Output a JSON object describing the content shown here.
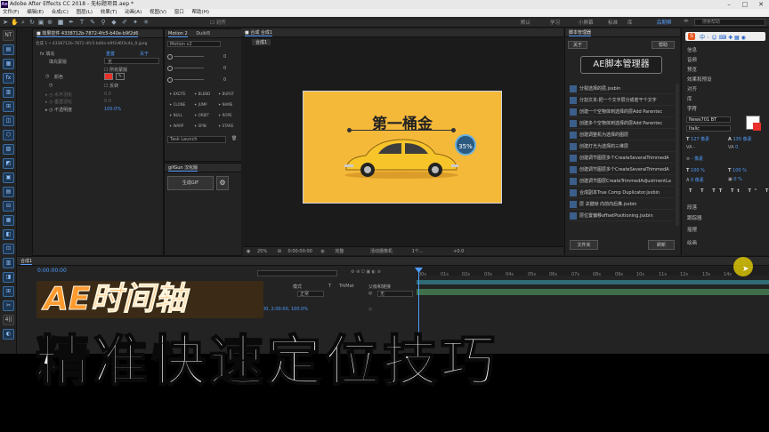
{
  "window": {
    "title": "Adobe After Effects CC 2018 - 无标题项目.aep *",
    "app_badge": "Ae"
  },
  "menu": [
    "文件(F)",
    "编辑(E)",
    "合成(C)",
    "图层(L)",
    "效果(T)",
    "动画(A)",
    "视图(V)",
    "窗口",
    "帮助(H)"
  ],
  "toolbar": {
    "align_label": "对齐",
    "workspaces": [
      "默认",
      "学习",
      "小屏幕",
      "标准",
      "库",
      "后期帮",
      "≫"
    ],
    "active_workspace": "后期帮",
    "search_placeholder": "搜索帮助"
  },
  "effects_panel": {
    "tab": "■ 效果控件 4338712b-7872-4fc5-b40e-b9f2d6",
    "path": "合成 1 • 4338712b-7872-4fc5-b40e-b9f2d6f3c4a_0.jpeg",
    "fx_name": "填充",
    "reset": "重置",
    "about": "关于",
    "mask_label": "填充蒙版",
    "mask_value": "无",
    "all_masks": "所有蒙版",
    "color_label": "颜色",
    "invert": "反转",
    "h_feather": "水平羽化",
    "v_feather": "垂直羽化",
    "opacity_label": "不透明度",
    "opacity_value": "100.0%",
    "feather_value": "0.0"
  },
  "motion_panel": {
    "tabs": [
      "Motion 2",
      "DuikI5"
    ],
    "preset": "Motion v2",
    "value": "0",
    "buttons": [
      "EXCITE",
      "BLEND",
      "BURST",
      "CLONE",
      "JUMP",
      "NAME",
      "NULL",
      "ORBIT",
      "ROPE",
      "WARP",
      "SPIN",
      "STARE"
    ],
    "task": "Task Launch",
    "gif_tab": "gifGun 汉化版",
    "gif_button": "生成GIF"
  },
  "comp_panel": {
    "tab": "■ 合成 合成1",
    "sub_tab": "合成1",
    "zoom": "25%",
    "timecode": "0:00:00:00",
    "quality": "完整",
    "camera": "活动摄像机",
    "views": "1个...",
    "exposure": "+0.0"
  },
  "canvas": {
    "headline": "第一桶金",
    "progress_badge": "35%"
  },
  "script_panel": {
    "tab": "脚本管理器",
    "about": "关于",
    "help": "帮助",
    "logo": "AE脚本管理器",
    "items": [
      "分裂选择的层.jsxbin",
      "分割文本:把一个文字层分成若干个文字",
      "创建一个空物体到选择的层Add Parentec",
      "创建多个空物体到选择的层Add Parentec",
      "创建调整机为选择的图层",
      "创建灯光为选择的三维层",
      "创建调节图层多个CreateSeveralTrimmedA",
      "创建调节图层多个CreateSeveralTrimmedA",
      "创建调节图层CreateTrimmedAdjustmentLa",
      "合成副本True Comp Duplicator.jsxbin",
      "层 关键帧 向前向后推.jsxbin",
      "层位置偏移offsetPositioning.jsxbin"
    ],
    "folder_button": "文件夹",
    "refresh_button": "刷新"
  },
  "right_panel": {
    "items": [
      "信息",
      "音频",
      "预览",
      "效果和预设",
      "对齐",
      "库",
      "字符"
    ],
    "font": "News701 BT",
    "style": "Italic",
    "size": "127 像素",
    "leading": "135 像素",
    "tracking": "0",
    "px_auto": "- 像素",
    "scale_v": "100 %",
    "scale_h": "100 %",
    "baseline": "0 像素",
    "tsume": "0 %",
    "bottom_items": [
      "段落",
      "跟踪器",
      "摇摆",
      "绘画"
    ]
  },
  "timeline": {
    "tab": "合成1",
    "timecode": "0:00:00:00",
    "columns": [
      "模式",
      "T",
      "TrkMat",
      "父级和链接"
    ],
    "mode_value": "正常",
    "parent_value": "无",
    "layer_time": "0:00:00:00, 2:00:00, 100.0%",
    "ruler": [
      "00s",
      "01s",
      "02s",
      "03s",
      "04s",
      "05s",
      "06s",
      "07s",
      "08s",
      "09s",
      "10s",
      "11s",
      "12s",
      "13s",
      "14s"
    ]
  },
  "overlay": {
    "tag": "AE时间轴",
    "subtitle": "精准快速定位技巧"
  },
  "colors": {
    "accent": "#4f9cff",
    "canvas_bg": "#f5b93a",
    "tag_orange": "#ff9a2e",
    "red_swatch": "#e8312a"
  }
}
